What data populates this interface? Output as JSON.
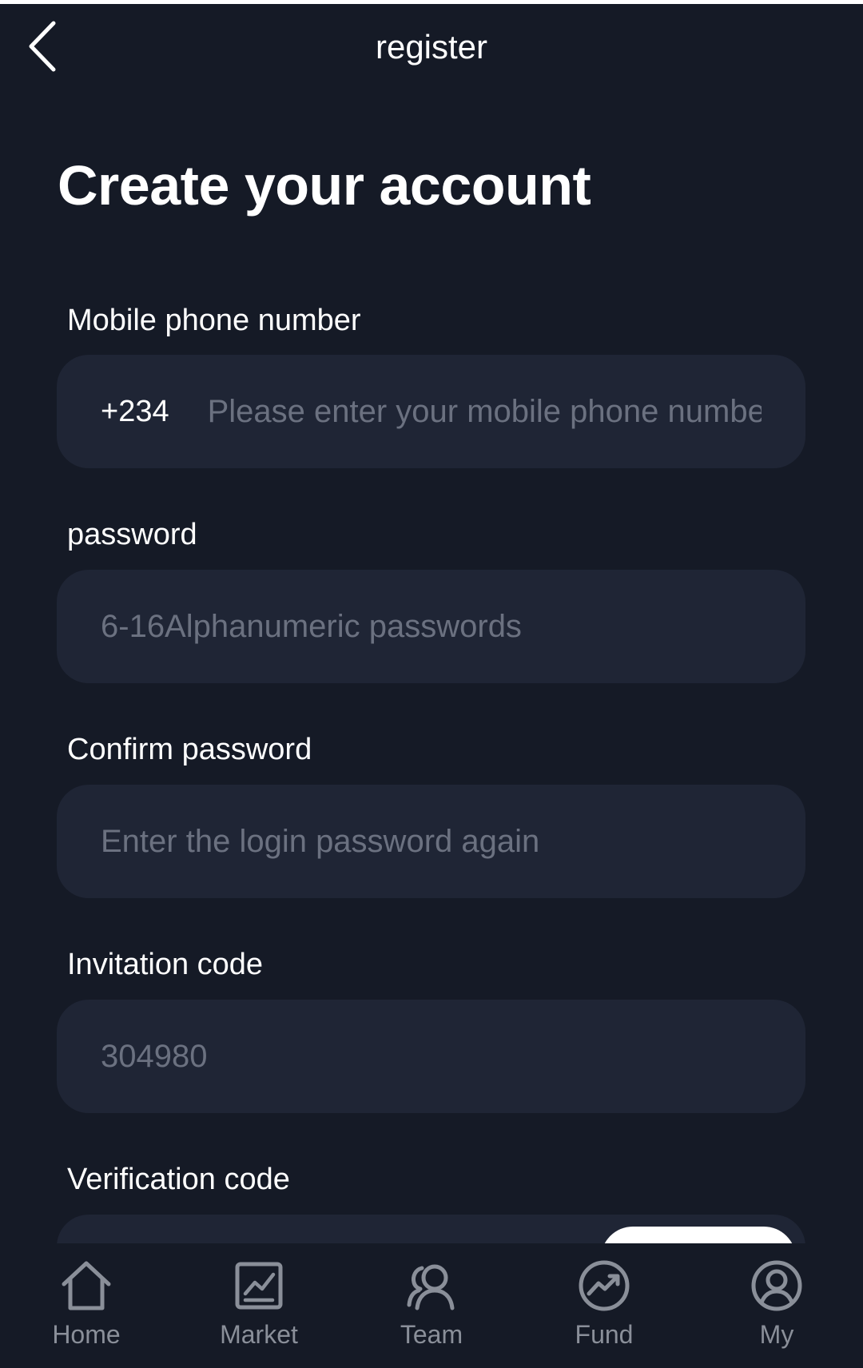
{
  "header": {
    "title": "register",
    "back_icon": "chevron-left-icon"
  },
  "page_title": "Create your account",
  "form": {
    "phone": {
      "label": "Mobile phone number",
      "prefix": "+234",
      "placeholder": "Please enter your mobile phone number",
      "value": ""
    },
    "password": {
      "label": "password",
      "placeholder": "6-16Alphanumeric passwords",
      "value": ""
    },
    "confirm_password": {
      "label": "Confirm password",
      "placeholder": "Enter the login password again",
      "value": ""
    },
    "invitation_code": {
      "label": "Invitation code",
      "placeholder": "304980",
      "value": ""
    },
    "verification_code": {
      "label": "Verification code",
      "value": ""
    }
  },
  "bottom_nav": {
    "items": [
      {
        "label": "Home",
        "icon": "home-icon"
      },
      {
        "label": "Market",
        "icon": "market-chart-icon"
      },
      {
        "label": "Team",
        "icon": "team-icon"
      },
      {
        "label": "Fund",
        "icon": "fund-trend-icon"
      },
      {
        "label": "My",
        "icon": "user-profile-icon"
      }
    ]
  },
  "colors": {
    "background": "#151a26",
    "field_background": "#1f2535",
    "placeholder": "#6b7180",
    "nav_inactive": "#8a8f99",
    "text": "#ffffff"
  }
}
